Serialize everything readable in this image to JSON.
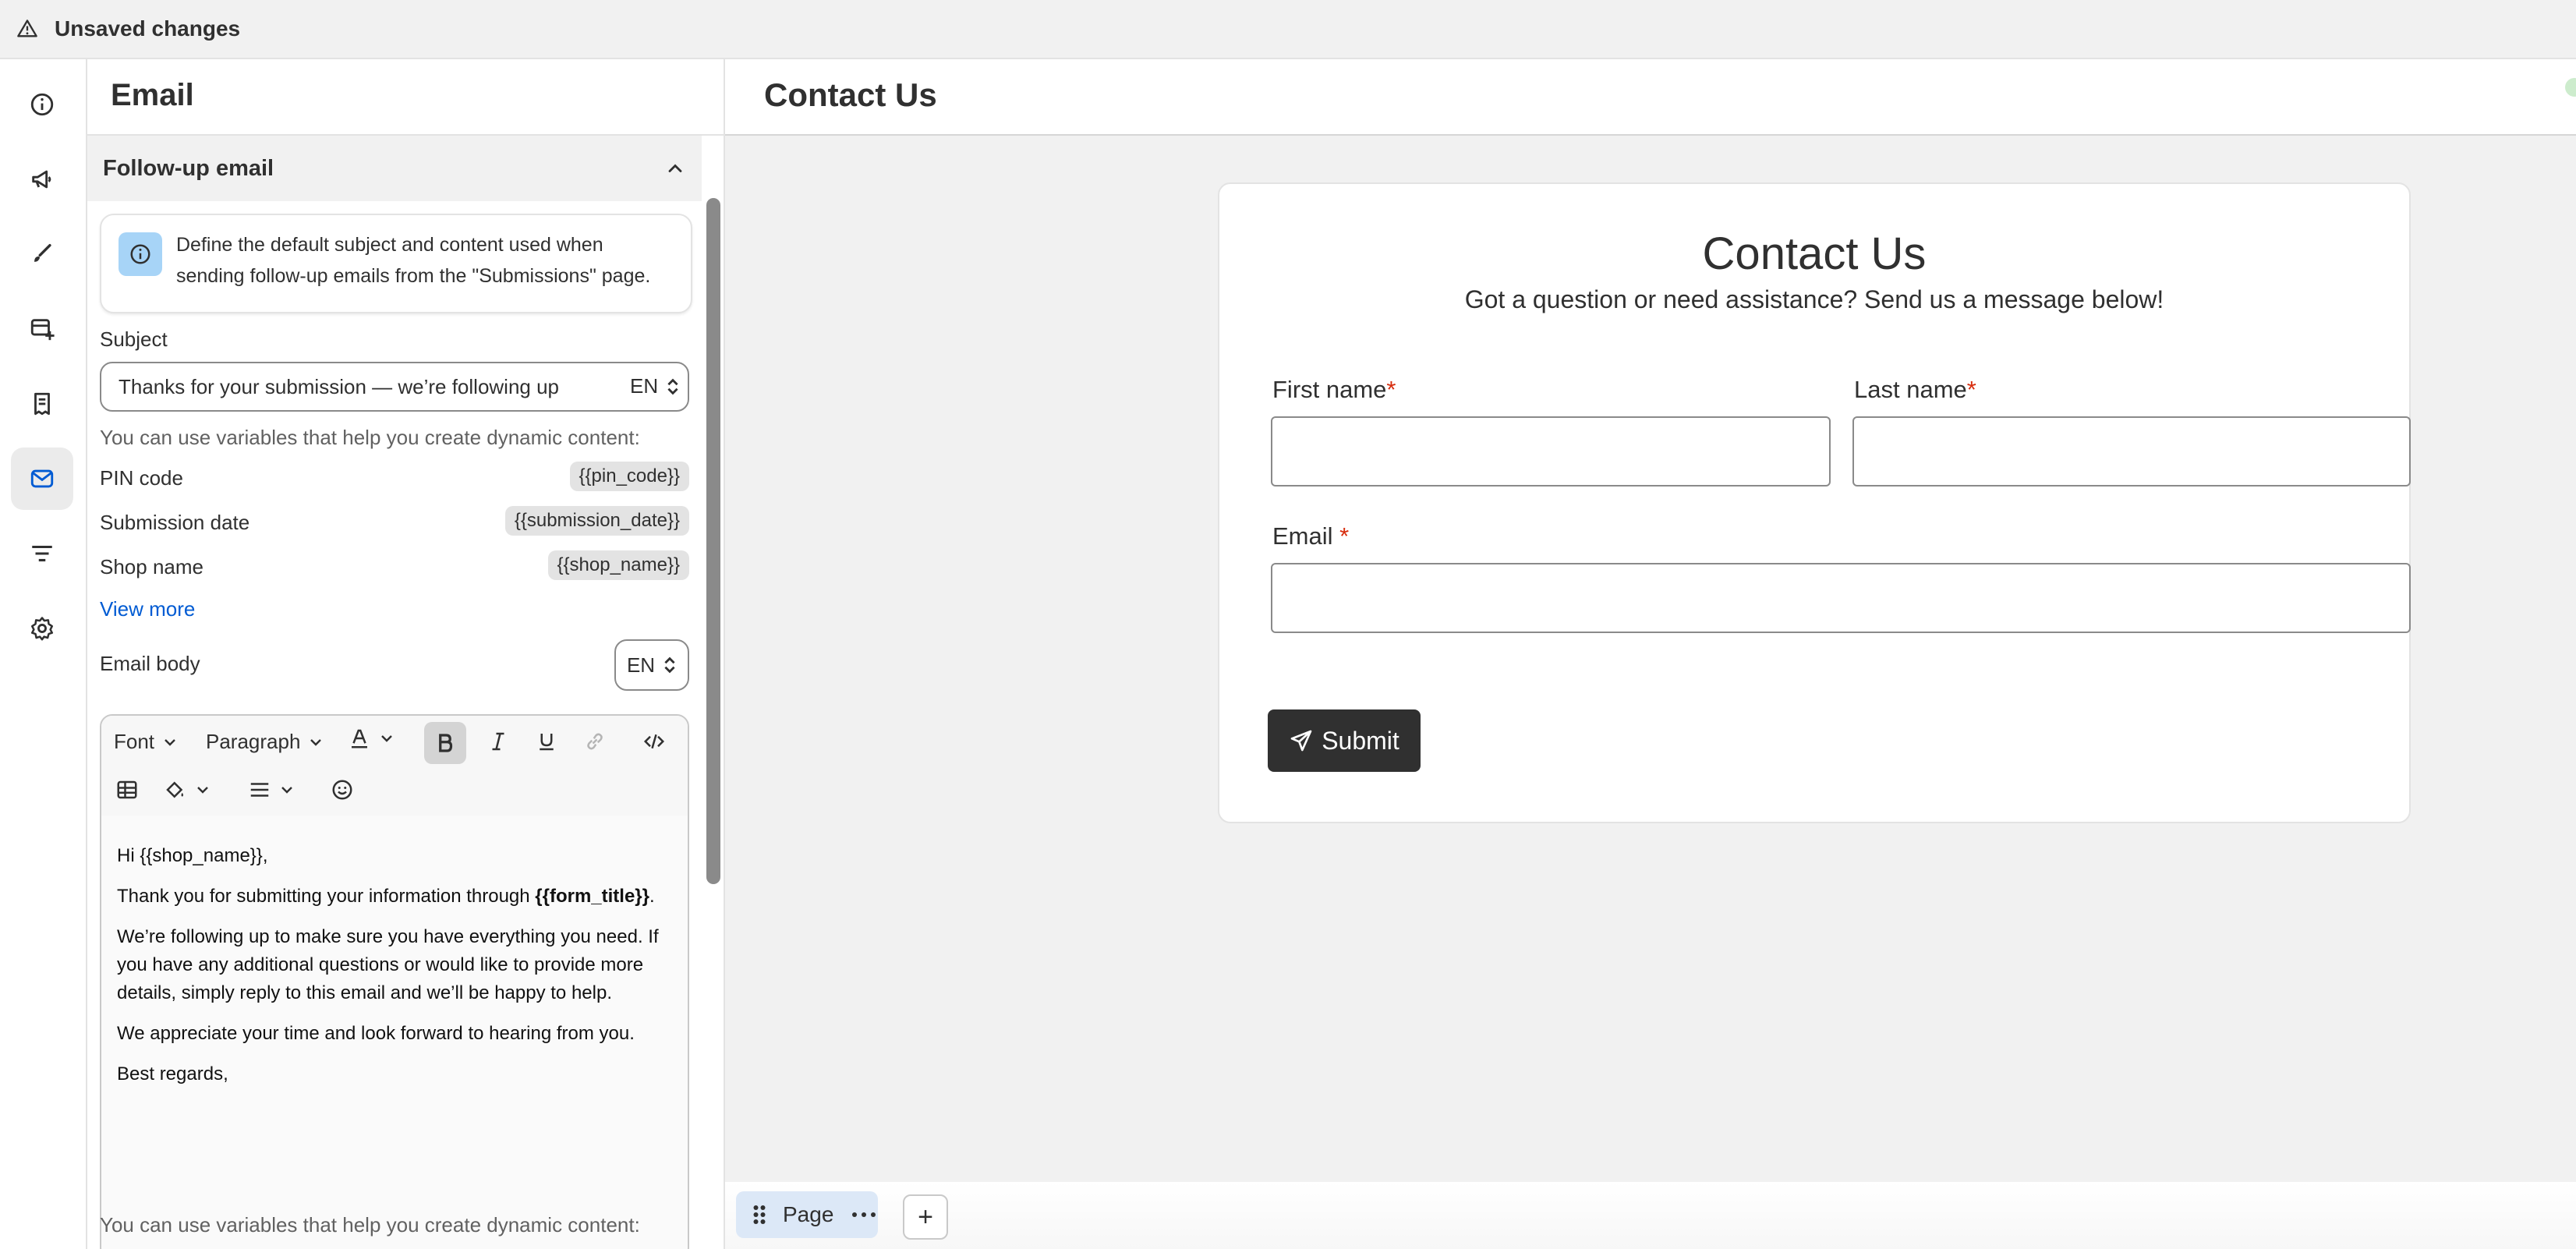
{
  "topbar": {
    "message": "Unsaved changes"
  },
  "rail": {
    "items": [
      {
        "icon": "info-icon"
      },
      {
        "icon": "megaphone-icon"
      },
      {
        "icon": "brush-icon"
      },
      {
        "icon": "form-add-icon"
      },
      {
        "icon": "receipt-icon"
      },
      {
        "icon": "email-icon",
        "active": true
      },
      {
        "icon": "filter-icon"
      },
      {
        "icon": "gear-icon"
      }
    ]
  },
  "panel": {
    "title": "Email",
    "section_title": "Follow-up email",
    "info_text": "Define the default subject and content used when sending follow-up emails from the \"Submissions\" page.",
    "subject_label": "Subject",
    "subject_value": "Thanks for your submission — we’re following up",
    "subject_lang": "EN",
    "variables_help": "You can use variables that help you create dynamic content:",
    "variables": [
      {
        "name": "PIN code",
        "token": "{{pin_code}}"
      },
      {
        "name": "Submission date",
        "token": "{{submission_date}}"
      },
      {
        "name": "Shop name",
        "token": "{{shop_name}}"
      }
    ],
    "view_more": "View more",
    "body_label": "Email body",
    "body_lang": "EN",
    "toolbar": {
      "font": "Font",
      "paragraph": "Paragraph"
    },
    "body": {
      "greeting": "Hi {{shop_name}},",
      "p1_a": "Thank you for submitting your information through",
      "p1_b": "{{form_title}}",
      "p1_c": ".",
      "p2": "We’re following up to make sure you have everything you need. If you have any additional questions or would like to provide more details, simply reply to this email and we’ll be happy to help.",
      "p3": "We appreciate your time and look forward to hearing from you.",
      "closing": "Best regards,"
    },
    "variables_help_2": "You can use variables that help you create dynamic content:"
  },
  "canvas": {
    "header_title": "Contact Us",
    "form": {
      "title": "Contact Us",
      "subtitle": "Got a question or need assistance? Send us a message below!",
      "first_name": "First name",
      "last_name": "Last name",
      "email": "Email",
      "required_mark": "*",
      "submit": "Submit"
    },
    "pages": {
      "page_label": "Page",
      "add": "+"
    }
  }
}
